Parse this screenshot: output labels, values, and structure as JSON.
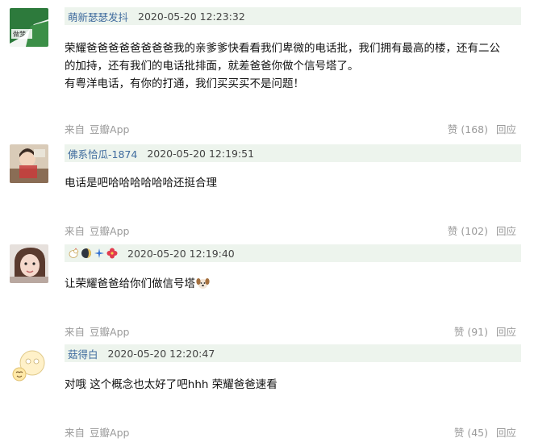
{
  "comments": [
    {
      "author": "萌新瑟瑟发抖",
      "avatar": "avatar-green-banner",
      "time": "2020-05-20 12:23:32",
      "lines": [
        "荣耀爸爸爸爸爸爸爸爸我的亲爹爹快看看我们卑微的电话批，我们拥有最高的楼，还有二公",
        "的加持，还有我们的电话批排面，就差爸爸你做个信号塔了。",
        "有粤洋电话，有你的打通，我们买买买不是问题！"
      ],
      "avatar_text": "做梦",
      "source_label": "来自",
      "app_label": "豆瓣App",
      "like_label": "赞 (168)",
      "reply_label": "回应"
    },
    {
      "author": "佛系恰瓜-1874",
      "avatar": "avatar-photo-person",
      "time": "2020-05-20 12:19:51",
      "lines": [
        "电话是吧哈哈哈哈哈哈还挺合理"
      ],
      "source_label": "来自",
      "app_label": "豆瓣App",
      "like_label": "赞 (102)",
      "reply_label": "回应"
    },
    {
      "author": "",
      "author_emoji": [
        "chicken-emoji",
        "new-moon-emoji",
        "sparkle-emoji",
        "hibiscus-emoji"
      ],
      "avatar": "avatar-photo-girl",
      "time": "2020-05-20 12:19:40",
      "lines": [
        "让荣耀爸爸给你们做信号塔"
      ],
      "line_emoji": "dog-face-emoji",
      "source_label": "来自",
      "app_label": "豆瓣App",
      "like_label": "赞 (91)",
      "reply_label": "回应"
    },
    {
      "author": "菇得白",
      "avatar": "avatar-emoji-faces",
      "time": "2020-05-20 12:20:47",
      "lines": [
        "对哦 这个概念也太好了吧hhh 荣耀爸爸速看"
      ],
      "source_label": "来自",
      "app_label": "豆瓣App",
      "like_label": "赞 (45)",
      "reply_label": "回应"
    }
  ],
  "colors": {
    "meta_bar_bg": "#edf4ed",
    "author_link": "#3f6b9e",
    "footer_gray": "#9a9a9a"
  }
}
